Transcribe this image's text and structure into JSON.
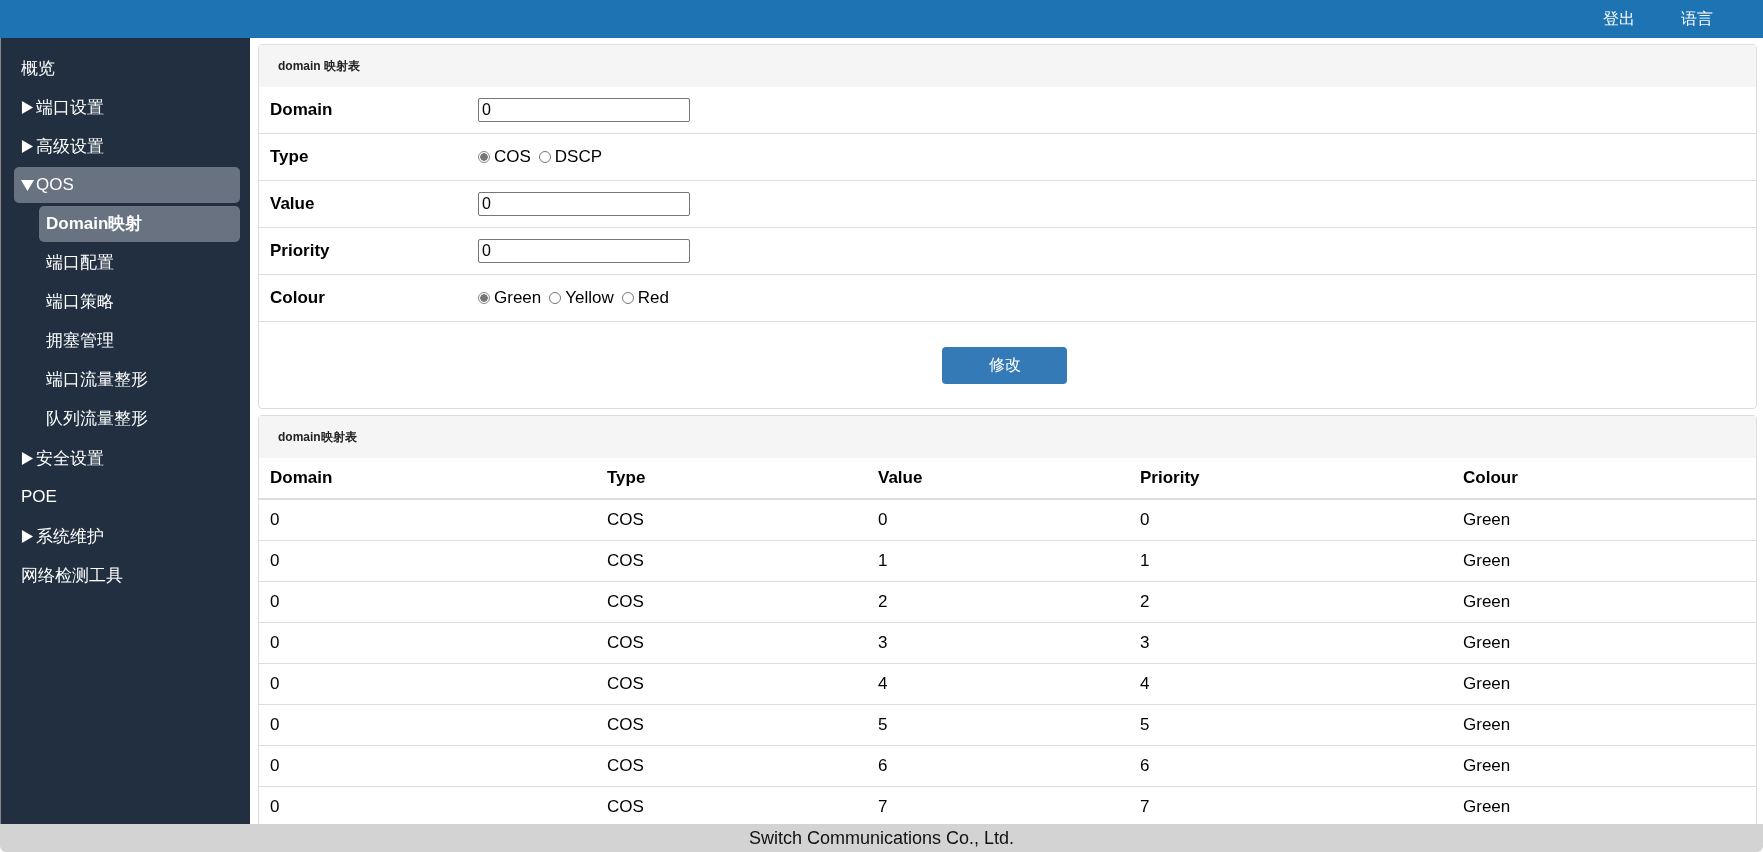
{
  "header": {
    "links": [
      "登出",
      "语言"
    ]
  },
  "sidebar": {
    "items": [
      {
        "label": "概览",
        "selected": false
      },
      {
        "label": "端口设置",
        "selected": false,
        "expanded": false
      },
      {
        "label": "高级设置",
        "selected": false,
        "expanded": false
      },
      {
        "label": "QOS",
        "selected": true,
        "expanded": true,
        "children": [
          {
            "label": "Domain映射",
            "selected": true
          },
          {
            "label": "端口配置",
            "selected": false
          },
          {
            "label": "端口策略",
            "selected": false
          },
          {
            "label": "拥塞管理",
            "selected": false
          },
          {
            "label": "端口流量整形",
            "selected": false
          },
          {
            "label": "队列流量整形",
            "selected": false
          }
        ]
      },
      {
        "label": "安全设置",
        "selected": false,
        "expanded": false
      },
      {
        "label": "POE",
        "selected": false
      },
      {
        "label": "系统维护",
        "selected": false,
        "expanded": false
      },
      {
        "label": "网络检测工具",
        "selected": false
      }
    ]
  },
  "form_panel": {
    "title": "domain 映射表",
    "fields": [
      {
        "kind": "text",
        "label": "Domain",
        "value": "0"
      },
      {
        "kind": "radio",
        "label": "Type",
        "options": [
          {
            "label": "COS",
            "selected": true
          },
          {
            "label": "DSCP",
            "selected": false
          }
        ]
      },
      {
        "kind": "text",
        "label": "Value",
        "value": "0"
      },
      {
        "kind": "text",
        "label": "Priority",
        "value": "0"
      },
      {
        "kind": "radio",
        "label": "Colour",
        "options": [
          {
            "label": "Green",
            "selected": true
          },
          {
            "label": "Yellow",
            "selected": false
          },
          {
            "label": "Red",
            "selected": false
          }
        ]
      }
    ],
    "button": "修改"
  },
  "table_panel": {
    "title": "domain映射表",
    "columns": [
      "Domain",
      "Type",
      "Value",
      "Priority",
      "Colour"
    ],
    "rows": [
      [
        "0",
        "COS",
        "0",
        "0",
        "Green"
      ],
      [
        "0",
        "COS",
        "1",
        "1",
        "Green"
      ],
      [
        "0",
        "COS",
        "2",
        "2",
        "Green"
      ],
      [
        "0",
        "COS",
        "3",
        "3",
        "Green"
      ],
      [
        "0",
        "COS",
        "4",
        "4",
        "Green"
      ],
      [
        "0",
        "COS",
        "5",
        "5",
        "Green"
      ],
      [
        "0",
        "COS",
        "6",
        "6",
        "Green"
      ],
      [
        "0",
        "COS",
        "7",
        "7",
        "Green"
      ]
    ]
  },
  "footer": {
    "text": "Switch Communications Co., Ltd."
  }
}
